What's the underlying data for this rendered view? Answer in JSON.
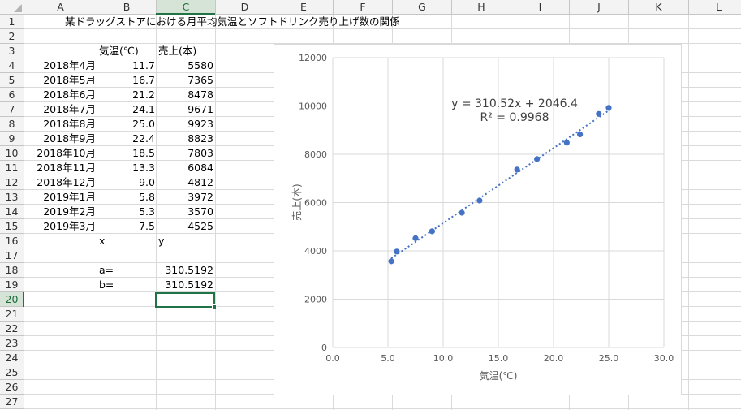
{
  "columns": [
    "A",
    "B",
    "C",
    "D",
    "E",
    "F",
    "G",
    "H",
    "I",
    "J",
    "K",
    "L"
  ],
  "rows": [
    "1",
    "2",
    "3",
    "4",
    "5",
    "6",
    "7",
    "8",
    "9",
    "10",
    "11",
    "12",
    "13",
    "14",
    "15",
    "16",
    "17",
    "18",
    "19",
    "20",
    "21",
    "22",
    "23",
    "24",
    "25",
    "26",
    "27"
  ],
  "selected_cell": "C20",
  "title": "某ドラッグストアにおける月平均気温とソフトドリンク売り上げ数の関係",
  "header_temp": "気温(℃)",
  "header_sales": "売上(本)",
  "table": [
    {
      "month": "2018年4月",
      "temp": "11.7",
      "sales": "5580"
    },
    {
      "month": "2018年5月",
      "temp": "16.7",
      "sales": "7365"
    },
    {
      "month": "2018年6月",
      "temp": "21.2",
      "sales": "8478"
    },
    {
      "month": "2018年7月",
      "temp": "24.1",
      "sales": "9671"
    },
    {
      "month": "2018年8月",
      "temp": "25.0",
      "sales": "9923"
    },
    {
      "month": "2018年9月",
      "temp": "22.4",
      "sales": "8823"
    },
    {
      "month": "2018年10月",
      "temp": "18.5",
      "sales": "7803"
    },
    {
      "month": "2018年11月",
      "temp": "13.3",
      "sales": "6084"
    },
    {
      "month": "2018年12月",
      "temp": "9.0",
      "sales": "4812"
    },
    {
      "month": "2019年1月",
      "temp": "5.8",
      "sales": "3972"
    },
    {
      "month": "2019年2月",
      "temp": "5.3",
      "sales": "3570"
    },
    {
      "month": "2019年3月",
      "temp": "7.5",
      "sales": "4525"
    }
  ],
  "label_x": "x",
  "label_y": "y",
  "label_a": "a=",
  "label_b": "b=",
  "value_a": "310.5192",
  "value_b": "310.5192",
  "chart_data": {
    "type": "scatter",
    "xlabel": "気温(℃)",
    "ylabel": "売上(本)",
    "xlim": [
      0,
      30
    ],
    "ylim": [
      0,
      12000
    ],
    "x_ticks": [
      "0.0",
      "5.0",
      "10.0",
      "15.0",
      "20.0",
      "25.0",
      "30.0"
    ],
    "y_ticks": [
      "0",
      "2000",
      "4000",
      "6000",
      "8000",
      "10000",
      "12000"
    ],
    "grid": true,
    "point_color": "#4472c4",
    "trendline": {
      "slope": 310.52,
      "intercept": 2046.4,
      "style": "dotted",
      "color": "#4472c4"
    },
    "equation": "y = 310.52x + 2046.4",
    "r_squared": "R² = 0.9968",
    "points": [
      {
        "x": 11.7,
        "y": 5580
      },
      {
        "x": 16.7,
        "y": 7365
      },
      {
        "x": 21.2,
        "y": 8478
      },
      {
        "x": 24.1,
        "y": 9671
      },
      {
        "x": 25.0,
        "y": 9923
      },
      {
        "x": 22.4,
        "y": 8823
      },
      {
        "x": 18.5,
        "y": 7803
      },
      {
        "x": 13.3,
        "y": 6084
      },
      {
        "x": 9.0,
        "y": 4812
      },
      {
        "x": 5.8,
        "y": 3972
      },
      {
        "x": 5.3,
        "y": 3570
      },
      {
        "x": 7.5,
        "y": 4525
      }
    ]
  }
}
